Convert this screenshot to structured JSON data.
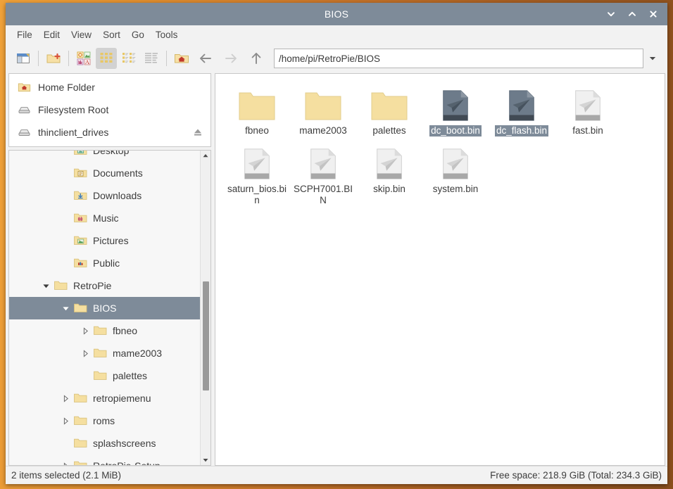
{
  "window": {
    "title": "BIOS",
    "controls": [
      {
        "name": "minimize-button",
        "glyph": "chevron-down"
      },
      {
        "name": "maximize-button",
        "glyph": "chevron-up"
      },
      {
        "name": "close-button",
        "glyph": "close"
      }
    ]
  },
  "menubar": {
    "items": [
      "File",
      "Edit",
      "View",
      "Sort",
      "Go",
      "Tools"
    ]
  },
  "toolbar": {
    "buttons": [
      {
        "name": "new-window-button",
        "icon": "new-window-icon",
        "active": false
      },
      {
        "name": "new-folder-button",
        "icon": "new-folder-icon",
        "active": false
      },
      {
        "name": "view-thumbnails-button",
        "icon": "thumbnails-icon",
        "active": false
      },
      {
        "name": "view-icons-button",
        "icon": "icon-view-icon",
        "active": true
      },
      {
        "name": "view-compact-button",
        "icon": "compact-view-icon",
        "active": false
      },
      {
        "name": "view-detailed-button",
        "icon": "detailed-list-icon",
        "active": false
      },
      {
        "name": "home-button",
        "icon": "home-folder-icon",
        "active": false
      }
    ],
    "nav": [
      {
        "name": "back-button",
        "icon": "arrow-left-icon",
        "enabled": true
      },
      {
        "name": "forward-button",
        "icon": "arrow-right-icon",
        "enabled": false
      },
      {
        "name": "up-button",
        "icon": "arrow-up-icon",
        "enabled": true
      }
    ],
    "path_value": "/home/pi/RetroPie/BIOS",
    "path_placeholder": "Path",
    "dropdown_icon": "chevron-down-icon"
  },
  "places": [
    {
      "label": "Home Folder",
      "icon": "home-folder-icon",
      "eject": false
    },
    {
      "label": "Filesystem Root",
      "icon": "drive-icon",
      "eject": false
    },
    {
      "label": "thinclient_drives",
      "icon": "drive-icon",
      "eject": true
    }
  ],
  "tree": {
    "rows": [
      {
        "label": "Desktop",
        "indent": 2,
        "twisty": "none",
        "icon": "folder-desktop-icon",
        "selected": false
      },
      {
        "label": "Documents",
        "indent": 2,
        "twisty": "none",
        "icon": "folder-documents-icon",
        "selected": false
      },
      {
        "label": "Downloads",
        "indent": 2,
        "twisty": "none",
        "icon": "folder-downloads-icon",
        "selected": false
      },
      {
        "label": "Music",
        "indent": 2,
        "twisty": "none",
        "icon": "folder-music-icon",
        "selected": false
      },
      {
        "label": "Pictures",
        "indent": 2,
        "twisty": "none",
        "icon": "folder-pictures-icon",
        "selected": false
      },
      {
        "label": "Public",
        "indent": 2,
        "twisty": "none",
        "icon": "folder-public-icon",
        "selected": false
      },
      {
        "label": "RetroPie",
        "indent": 1,
        "twisty": "expanded",
        "icon": "folder-icon",
        "selected": false
      },
      {
        "label": "BIOS",
        "indent": 2,
        "twisty": "expanded",
        "icon": "folder-icon",
        "selected": true
      },
      {
        "label": "fbneo",
        "indent": 3,
        "twisty": "collapsed",
        "icon": "folder-icon",
        "selected": false
      },
      {
        "label": "mame2003",
        "indent": 3,
        "twisty": "collapsed",
        "icon": "folder-icon",
        "selected": false
      },
      {
        "label": "palettes",
        "indent": 3,
        "twisty": "none",
        "icon": "folder-icon",
        "selected": false
      },
      {
        "label": "retropiemenu",
        "indent": 2,
        "twisty": "collapsed",
        "icon": "folder-icon",
        "selected": false
      },
      {
        "label": "roms",
        "indent": 2,
        "twisty": "collapsed",
        "icon": "folder-icon",
        "selected": false
      },
      {
        "label": "splashscreens",
        "indent": 2,
        "twisty": "none",
        "icon": "folder-icon",
        "selected": false
      },
      {
        "label": "RetroPie-Setup",
        "indent": 2,
        "twisty": "collapsed",
        "icon": "folder-icon",
        "selected": false
      }
    ],
    "scrollbar": {
      "up_icon": "scroll-up-icon",
      "down_icon": "scroll-down-icon"
    }
  },
  "files": [
    {
      "name": "fbneo",
      "type": "folder",
      "selected": false
    },
    {
      "name": "mame2003",
      "type": "folder",
      "selected": false
    },
    {
      "name": "palettes",
      "type": "folder",
      "selected": false
    },
    {
      "name": "dc_boot.bin",
      "type": "file",
      "selected": true
    },
    {
      "name": "dc_flash.bin",
      "type": "file",
      "selected": true
    },
    {
      "name": "fast.bin",
      "type": "file",
      "selected": false
    },
    {
      "name": "saturn_bios.bin",
      "type": "file",
      "selected": false
    },
    {
      "name": "SCPH7001.BIN",
      "type": "file",
      "selected": false
    },
    {
      "name": "skip.bin",
      "type": "file",
      "selected": false
    },
    {
      "name": "system.bin",
      "type": "file",
      "selected": false
    }
  ],
  "statusbar": {
    "selection": "2 items selected (2.1 MiB)",
    "free_space": "Free space: 218.9 GiB (Total: 234.3 GiB)"
  },
  "colors": {
    "titlebar": "#7e8b99",
    "selection": "#7e8b99",
    "chrome": "#f2f2f2",
    "folder": "#f5dfa0",
    "desktop": "#d98b2b"
  }
}
